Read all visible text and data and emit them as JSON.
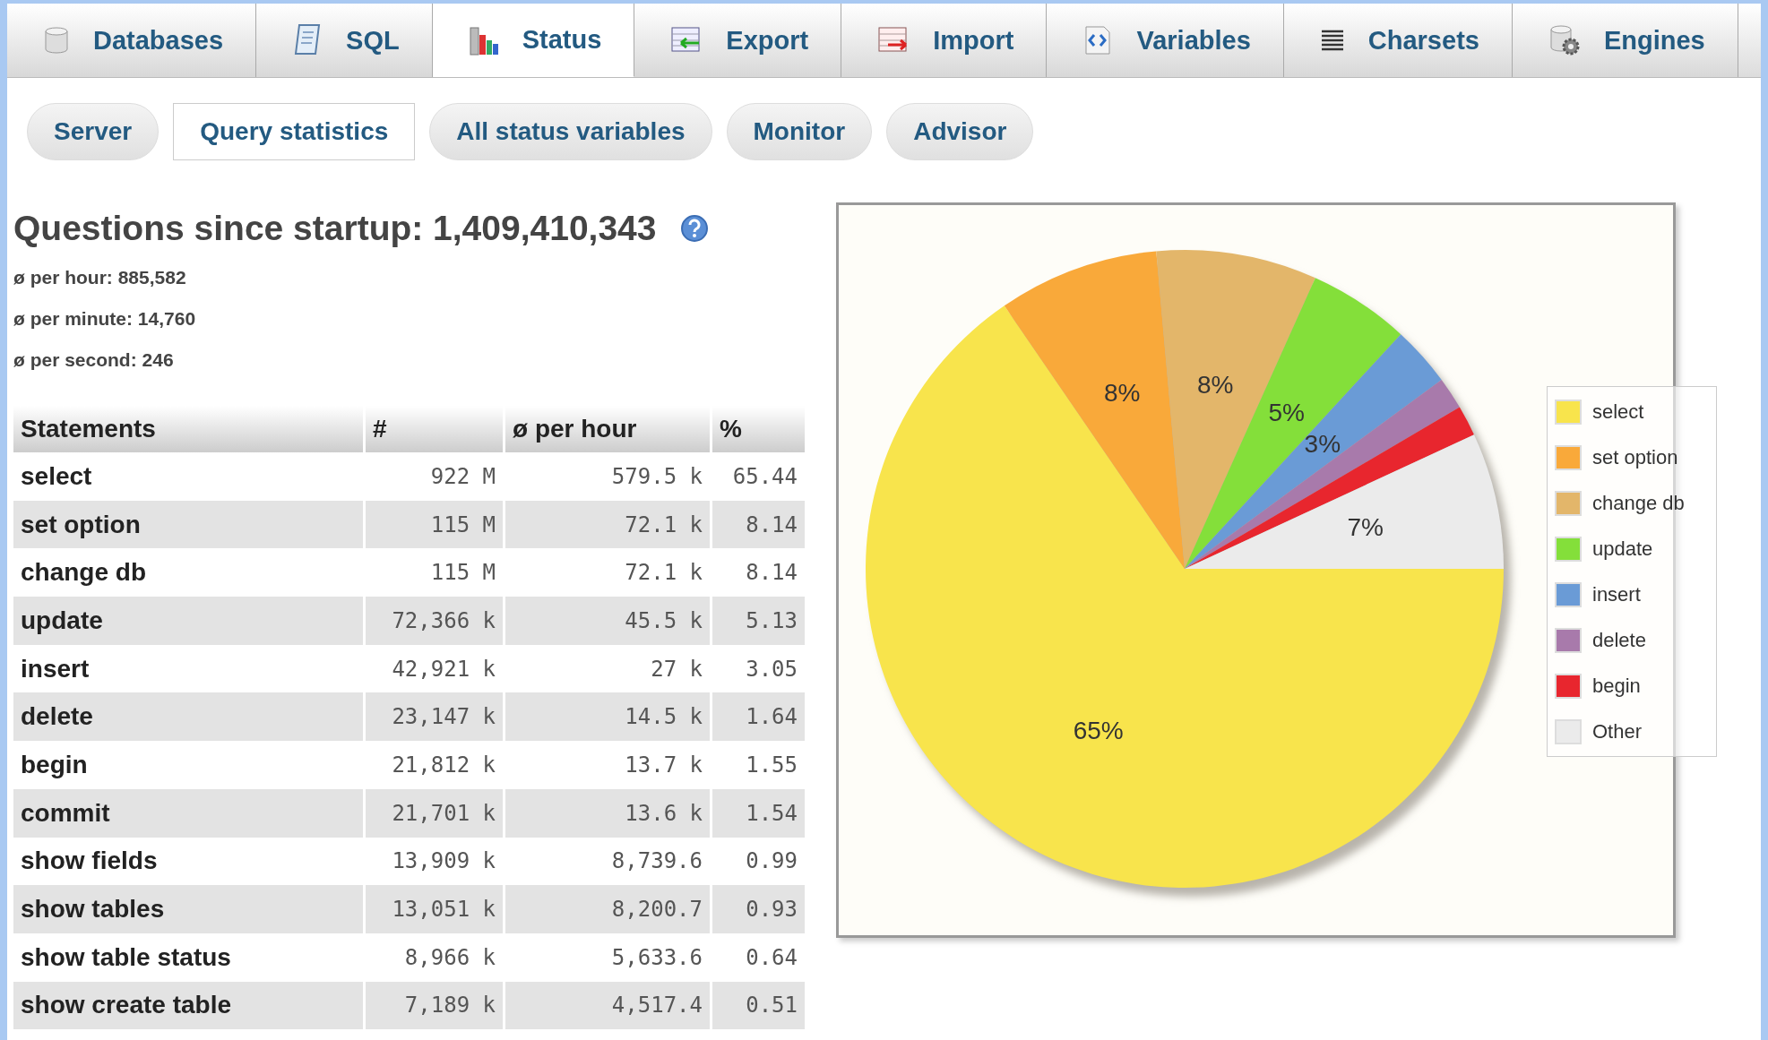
{
  "tabs": [
    {
      "label": "Databases",
      "selected": false
    },
    {
      "label": "SQL",
      "selected": false
    },
    {
      "label": "Status",
      "selected": true
    },
    {
      "label": "Export",
      "selected": false
    },
    {
      "label": "Import",
      "selected": false
    },
    {
      "label": "Variables",
      "selected": false
    },
    {
      "label": "Charsets",
      "selected": false
    },
    {
      "label": "Engines",
      "selected": false
    }
  ],
  "subtabs": [
    {
      "label": "Server",
      "selected": false
    },
    {
      "label": "Query statistics",
      "selected": true
    },
    {
      "label": "All status variables",
      "selected": false
    },
    {
      "label": "Monitor",
      "selected": false
    },
    {
      "label": "Advisor",
      "selected": false
    }
  ],
  "summary": {
    "heading": "Questions since startup: 1,409,410,343",
    "lines": [
      "ø per hour: 885,582",
      "ø per minute: 14,760",
      "ø per second: 246"
    ]
  },
  "table": {
    "columns": [
      "Statements",
      "#",
      "ø per hour",
      "%"
    ],
    "rows": [
      [
        "select",
        "922 M",
        "579.5 k",
        "65.44"
      ],
      [
        "set option",
        "115 M",
        "72.1 k",
        "8.14"
      ],
      [
        "change db",
        "115 M",
        "72.1 k",
        "8.14"
      ],
      [
        "update",
        "72,366 k",
        "45.5 k",
        "5.13"
      ],
      [
        "insert",
        "42,921 k",
        "27 k",
        "3.05"
      ],
      [
        "delete",
        "23,147 k",
        "14.5 k",
        "1.64"
      ],
      [
        "begin",
        "21,812 k",
        "13.7 k",
        "1.55"
      ],
      [
        "commit",
        "21,701 k",
        "13.6 k",
        "1.54"
      ],
      [
        "show fields",
        "13,909 k",
        "8,739.6",
        "0.99"
      ],
      [
        "show tables",
        "13,051 k",
        "8,200.7",
        "0.93"
      ],
      [
        "show table status",
        "8,966 k",
        "5,633.6",
        "0.64"
      ],
      [
        "show create table",
        "7,189 k",
        "4,517.4",
        "0.51"
      ]
    ]
  },
  "chart": {
    "chart_data": {
      "type": "pie",
      "categories": [
        "select",
        "set option",
        "change db",
        "update",
        "insert",
        "delete",
        "begin",
        "Other"
      ],
      "values": [
        65.44,
        8.14,
        8.14,
        5.13,
        3.05,
        1.64,
        1.55,
        6.91
      ],
      "value_labels": [
        "65%",
        "8%",
        "8%",
        "5%",
        "3%",
        null,
        null,
        "7%"
      ],
      "colors": [
        "#f8e44c",
        "#f9a93a",
        "#e3b66a",
        "#84df3a",
        "#6a9bd6",
        "#a87aab",
        "#e8262e",
        "#ebebeb"
      ]
    }
  }
}
